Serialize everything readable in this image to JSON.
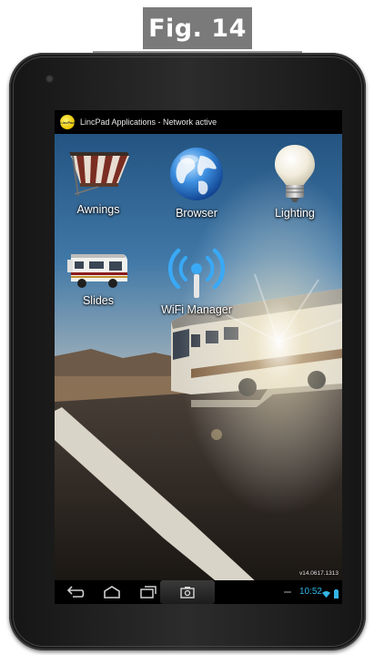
{
  "figure": {
    "label": "Fig. 14"
  },
  "status_bar": {
    "app_icon_text": "LincPad",
    "title": "LincPad Applications - Network active"
  },
  "apps": [
    {
      "label": "Awnings",
      "icon": "awning-icon"
    },
    {
      "label": "Browser",
      "icon": "globe-icon"
    },
    {
      "label": "Lighting",
      "icon": "lightbulb-icon"
    },
    {
      "label": "Slides",
      "icon": "rv-slides-icon"
    },
    {
      "label": "WiFi Manager",
      "icon": "wifi-antenna-icon"
    }
  ],
  "version": "v14.0617.1313",
  "nav_bar": {
    "buttons": [
      "back-icon",
      "home-icon",
      "recent-apps-icon",
      "screenshot-icon"
    ],
    "time": "10:52",
    "status_icons": [
      "wifi-icon",
      "battery-icon"
    ],
    "accent_color": "#33b5e5"
  }
}
